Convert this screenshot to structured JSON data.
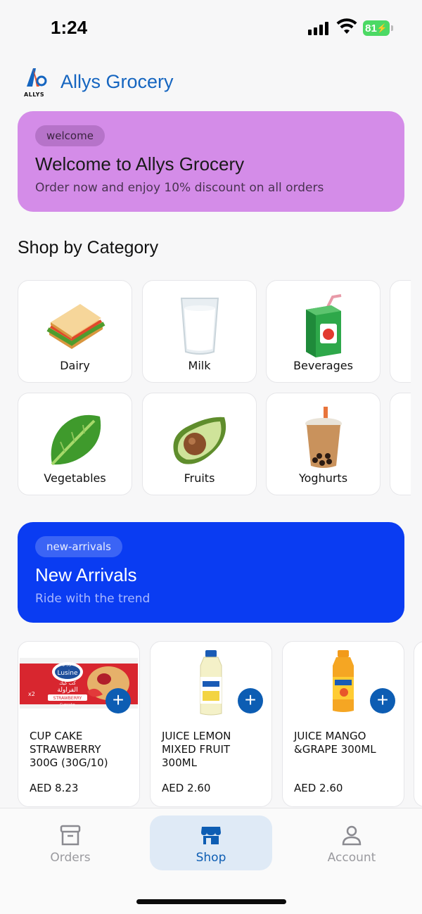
{
  "status": {
    "time": "1:24",
    "battery": "81"
  },
  "header": {
    "logo_text": "ALLYS",
    "title": "Allys Grocery"
  },
  "welcome_banner": {
    "chip": "welcome",
    "title": "Welcome to Allys Grocery",
    "subtitle": "Order now and enjoy 10% discount on all orders",
    "color": "#d48ce8"
  },
  "categories": {
    "title": "Shop by Category",
    "items": [
      {
        "label": "Dairy",
        "icon": "sandwich-icon"
      },
      {
        "label": "Milk",
        "icon": "milk-glass-icon"
      },
      {
        "label": "Beverages",
        "icon": "juice-box-icon"
      },
      {
        "label": "Vegetables",
        "icon": "lettuce-icon"
      },
      {
        "label": "Fruits",
        "icon": "avocado-icon"
      },
      {
        "label": "Yoghurts",
        "icon": "bubble-tea-icon"
      }
    ]
  },
  "arrivals_banner": {
    "chip": "new-arrivals",
    "title": "New Arrivals",
    "subtitle": "Ride with the trend",
    "color": "#0a3cf2"
  },
  "products": [
    {
      "name": "CUP CAKE STRAWBERRY 300G (30G/10)",
      "price": "AED 8.23",
      "img_label_top": "Lusine",
      "img_label_mid": "STRAWBERRY",
      "img_label_count": "x2",
      "img_label_arabic": "الفراولة",
      "img_label_arabic_top": "كب كيك",
      "img_label_bottom": "Cupcake",
      "img_label_logo": "لوزين"
    },
    {
      "name": "JUICE LEMON MIXED FRUIT 300ML",
      "price": "AED 2.60"
    },
    {
      "name": "JUICE MANGO &GRAPE 300ML",
      "price": "AED 2.60"
    }
  ],
  "add_symbol": "+",
  "nav": {
    "items": [
      {
        "label": "Orders",
        "icon": "box-icon"
      },
      {
        "label": "Shop",
        "icon": "store-icon"
      },
      {
        "label": "Account",
        "icon": "user-icon"
      }
    ],
    "active_color": "#0d5db3"
  }
}
